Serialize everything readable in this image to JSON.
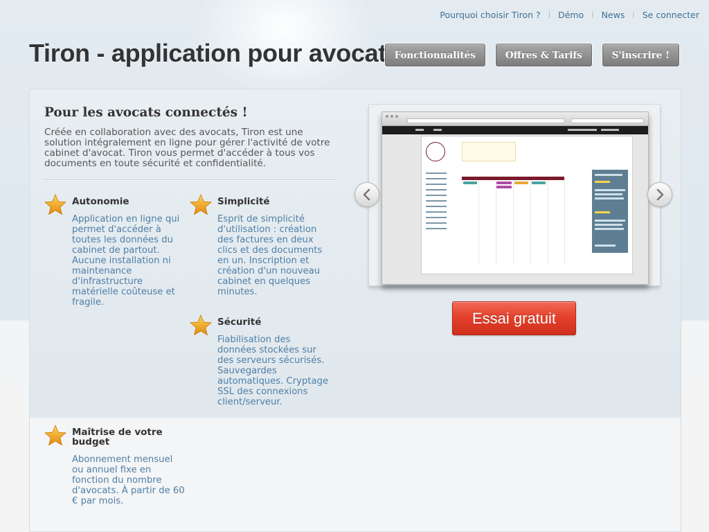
{
  "topnav": {
    "items": [
      {
        "label": "Pourquoi choisir Tiron ?"
      },
      {
        "label": "Démo"
      },
      {
        "label": "News"
      },
      {
        "label": "Se connecter"
      }
    ],
    "separator": "|"
  },
  "header": {
    "title": "Tiron - application pour avocats",
    "nav": [
      {
        "label": "Fonctionnalités"
      },
      {
        "label": "Offres & Tarifs"
      },
      {
        "label": "S'inscrire !"
      }
    ]
  },
  "intro": {
    "title": "Pour les avocats connectés !",
    "text": "Créée en collaboration avec des avocats, Tiron est une solution intégralement en ligne pour gérer l'activité de votre cabinet d'avocat. Tiron vous permet d'accéder à tous vos documents en toute sécurité et confidentialité."
  },
  "features": [
    {
      "icon": "star-icon",
      "title": "Autonomie",
      "text": "Application en ligne qui permet d'accéder à toutes les données du cabinet de partout. Aucune installation ni maintenance d'infrastructure matérielle coûteuse et fragile."
    },
    {
      "icon": "star-icon",
      "title": "Simplicité",
      "text": "Esprit de simplicité d'utilisation : création des factures en deux clics et des documents en un. Inscription et création d'un nouveau cabinet en quelques minutes."
    },
    {
      "icon": "star-icon",
      "title": "Sécurité",
      "text": "Fiabilisation des données stockées sur des serveurs sécurisés. Sauvegardes automatiques. Cryptage SSL des connexions client/serveur."
    },
    {
      "icon": "star-icon",
      "title": "Maîtrise de votre budget",
      "text": "Abonnement mensuel ou annuel fixe en fonction du nombre d'avocats. À partir de 60 € par mois."
    }
  ],
  "carousel": {
    "prev_icon": "chevron-left-icon",
    "next_icon": "chevron-right-icon"
  },
  "cta": {
    "label": "Essai gratuit"
  },
  "colors": {
    "link": "#3e6f93",
    "feature_text": "#4f7ea6",
    "cta": "#e4412c",
    "nav_button": "#8a8a8a",
    "star": "#f2a516"
  }
}
